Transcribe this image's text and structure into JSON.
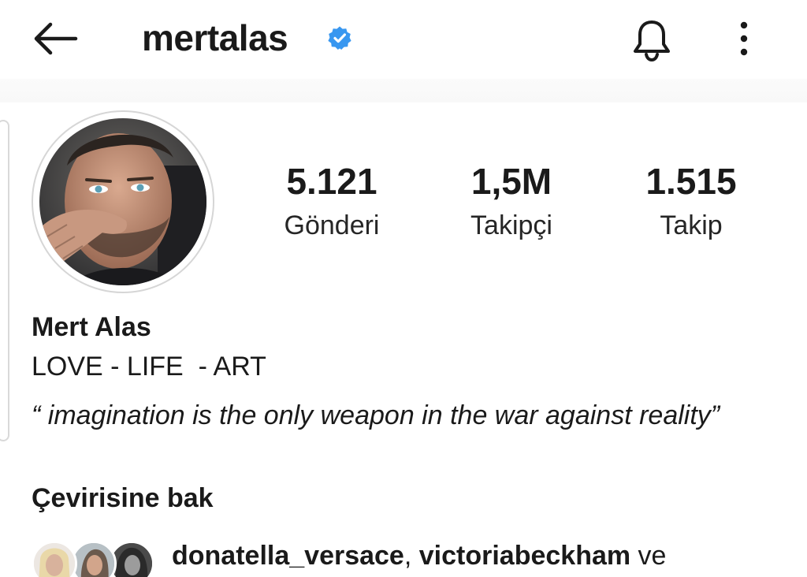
{
  "header": {
    "username": "mertalas",
    "icons": {
      "back": "arrow-left-icon",
      "verified": "verified-badge-icon",
      "notifications": "bell-icon",
      "more": "more-vertical-icon"
    },
    "verified_color": "#3897f0"
  },
  "profile": {
    "avatar": "profile-photo",
    "stats": [
      {
        "count": "5.121",
        "label": "Gönderi"
      },
      {
        "count": "1,5M",
        "label": "Takipçi"
      },
      {
        "count": "1.515",
        "label": "Takip"
      }
    ]
  },
  "bio": {
    "name": "Mert Alas",
    "line1": "LOVE - LIFE  - ART",
    "quote": "“ imagination is the only weapon in the war against reality”",
    "see_translation": "Çevirisine bak"
  },
  "followed_by": {
    "user1": "donatella_versace",
    "separator": ", ",
    "user2": "victoriabeckham",
    "suffix": " ve"
  }
}
